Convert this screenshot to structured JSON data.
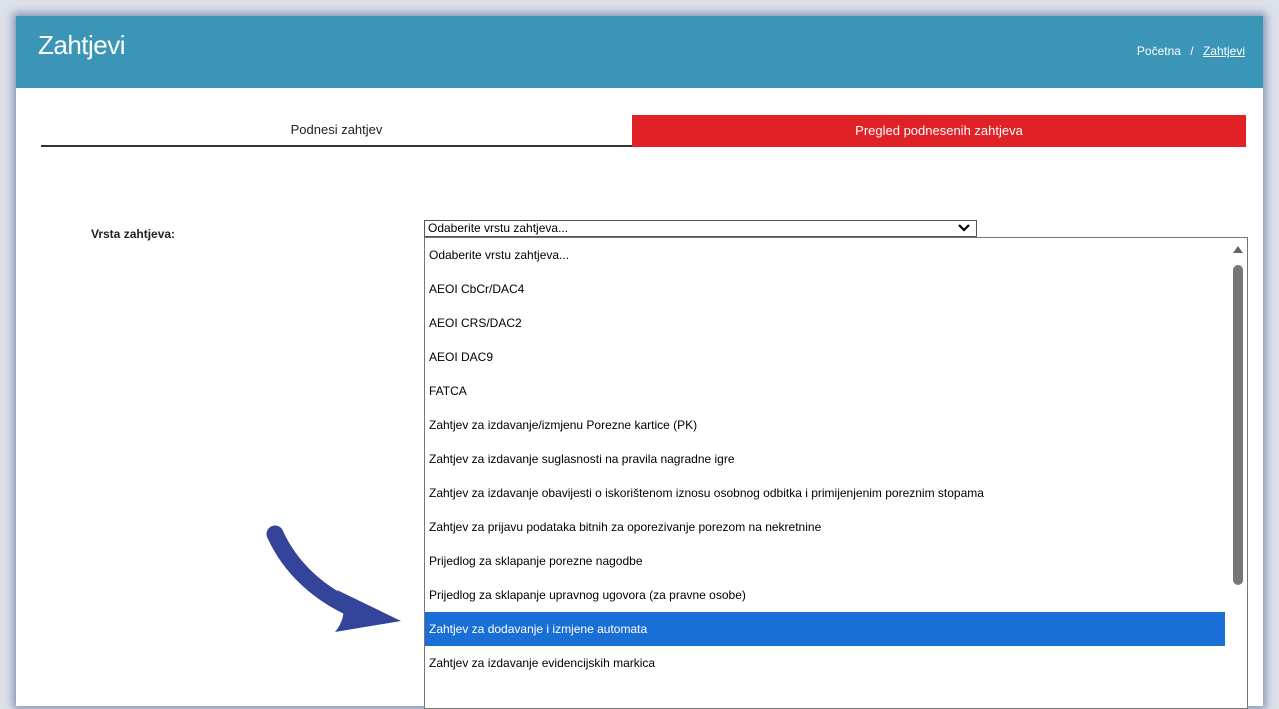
{
  "header": {
    "title": "Zahtjevi",
    "breadcrumb": {
      "home": "Početna",
      "separator": "/",
      "current": "Zahtjevi"
    }
  },
  "tabs": [
    {
      "label": "Podnesi zahtjev"
    },
    {
      "label": "Pregled podnesenih zahtjeva"
    }
  ],
  "form": {
    "label": "Vrsta zahtjeva:",
    "select_value": "Odaberite vrstu zahtjeva...",
    "options": [
      "Odaberite vrstu zahtjeva...",
      "AEOI CbCr/DAC4",
      "AEOI CRS/DAC2",
      "AEOI DAC9",
      "FATCA",
      "Zahtjev za izdavanje/izmjenu Porezne kartice (PK)",
      "Zahtjev za izdavanje suglasnosti na pravila nagradne igre",
      "Zahtjev za izdavanje obavijesti o iskorištenom iznosu osobnog odbitka i primijenjenim poreznim stopama",
      "Zahtjev za prijavu podataka bitnih za oporezivanje porezom na nekretnine",
      "Prijedlog za sklapanje porezne nagodbe",
      "Prijedlog za sklapanje upravnog ugovora (za pravne osobe)",
      "Zahtjev za dodavanje i izmjene automata",
      "Zahtjev za izdavanje evidencijskih markica"
    ],
    "selected_option": "Zahtjev za dodavanje i izmjene automata"
  },
  "colors": {
    "header_bg": "#3b95b7",
    "active_tab_bg": "#e02126",
    "selected_option_bg": "#1a6fd6",
    "arrow": "#34449a"
  },
  "icons": {
    "select_chevron": "chevron-down-icon",
    "annotation_arrow": "curved-arrow-icon",
    "scroll_up": "scroll-up-icon"
  }
}
